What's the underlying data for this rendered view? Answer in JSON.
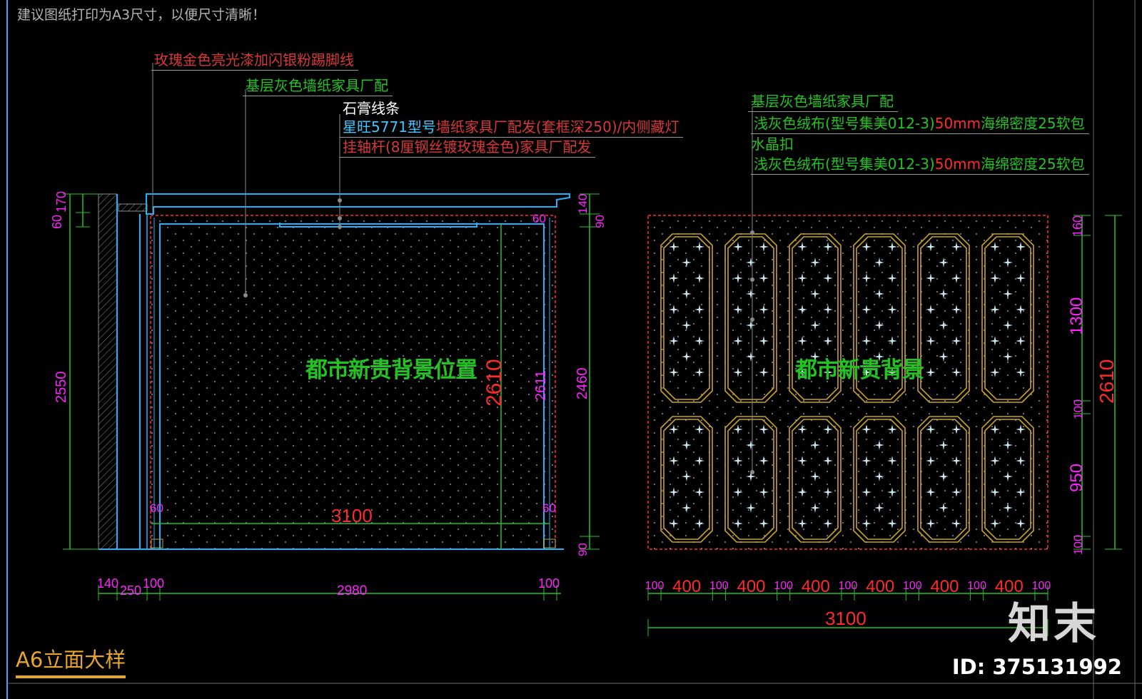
{
  "header_note": "建议图纸打印为A3尺寸，以便尺寸清晰！",
  "colors": {
    "background": "#000000",
    "cyan": "#19b4ff",
    "green": "#22c322",
    "red": "#ff2a2a",
    "magenta": "#ff22ff",
    "gold": "#c9a227",
    "gray": "#8c8c8c"
  },
  "left_callouts": [
    {
      "text": "玫瑰金色亮光漆加闪银粉踢脚线",
      "color": "#d83838"
    },
    {
      "text": "基层灰色墙纸家具厂配",
      "color": "#22c322"
    },
    {
      "text": "石膏线条",
      "color": "#ffffff"
    },
    {
      "text": "墙纸家具厂配发(套框深250)/内侧藏灯",
      "prefix": "星旺5771型号",
      "color": "#d83838"
    },
    {
      "text": "挂轴杆(8厘钢丝镀玫瑰金色)家具厂配发",
      "color": "#d83838"
    }
  ],
  "right_callouts": [
    {
      "text": "基层灰色墙纸家具厂配",
      "color": "#22c322"
    },
    {
      "prefix": "浅灰色绒布(型号集美012-3)",
      "mid": "50mm",
      "suffix": "海绵密度25软包",
      "color": "#22c322"
    },
    {
      "text": "水晶扣",
      "color": "#22c322"
    },
    {
      "prefix": "浅灰色绒布(型号集美012-3)",
      "mid": "50mm",
      "suffix": "海绵密度25软包",
      "color": "#22c322"
    }
  ],
  "left_elevation": {
    "center_label": "都市新贵背景位置",
    "left_dims": [
      "170",
      "60",
      "2550"
    ],
    "right_dims": [
      "140",
      "90",
      "2460",
      "90"
    ],
    "inner_vertical_dims": [
      "2610",
      "2611"
    ],
    "corner_dims": [
      "60",
      "60",
      "60"
    ],
    "inner_width": "3100",
    "bottom_dims": [
      "140",
      "250",
      "100",
      "2980",
      "100"
    ]
  },
  "right_elevation": {
    "center_label": "都市新贵背景",
    "right_dims": [
      "160",
      "1300",
      "100",
      "950",
      "100"
    ],
    "total_height": "2610",
    "bottom_dims": [
      "100",
      "400",
      "100",
      "400",
      "100",
      "400",
      "100",
      "400",
      "100",
      "400",
      "100",
      "400",
      "100"
    ],
    "total_width": "3100"
  },
  "drawing_title": "A6立面大样",
  "brand": "知末",
  "image_id": "ID: 375131992"
}
